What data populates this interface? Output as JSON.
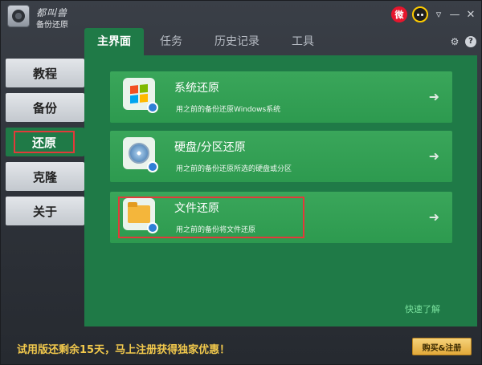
{
  "app": {
    "logo_title": "都叫兽",
    "logo_subtitle": "备份还原"
  },
  "tabs": [
    {
      "label": "主界面",
      "active": true
    },
    {
      "label": "任务",
      "active": false
    },
    {
      "label": "历史记录",
      "active": false
    },
    {
      "label": "工具",
      "active": false
    }
  ],
  "sidebar": {
    "items": [
      {
        "label": "教程",
        "active": false
      },
      {
        "label": "备份",
        "active": false
      },
      {
        "label": "还原",
        "active": true
      },
      {
        "label": "克隆",
        "active": false
      },
      {
        "label": "关于",
        "active": false
      }
    ]
  },
  "cards": [
    {
      "title": "系统还原",
      "description": "用之前的备份还原Windows系统",
      "icon": "windows-icon"
    },
    {
      "title": "硬盘/分区还原",
      "description": "用之前的备份还原所选的硬盘或分区",
      "icon": "disk-icon"
    },
    {
      "title": "文件还原",
      "description": "用之前的备份将文件还原",
      "icon": "folder-icon",
      "highlighted": true
    }
  ],
  "quick_link": "快速了解",
  "footer": {
    "promo": "试用版还剩余15天，马上注册获得独家优惠！",
    "buy_button": "购买&注册"
  },
  "colors": {
    "accent_green": "#1f7a47",
    "card_green": "#3aa65a",
    "highlight_red": "#e23a3a",
    "promo_yellow": "#f2c94c"
  }
}
